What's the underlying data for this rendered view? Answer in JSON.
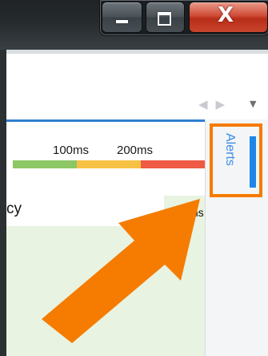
{
  "window": {
    "controls": {
      "minimize_icon": "minimize-icon",
      "maximize_icon": "maximize-icon",
      "close_glyph": "X"
    }
  },
  "toolbar": {
    "nav_prev": "◀",
    "nav_next": "▶",
    "nav_menu": "▼"
  },
  "latency_legend": {
    "labels": [
      "100ms",
      "200ms"
    ],
    "colors": {
      "good": "#8cc665",
      "warning": "#f7c244",
      "critical": "#ee5a44"
    }
  },
  "alerts_tab": {
    "label": "Alerts",
    "highlight_color": "#f57c00",
    "indicator_color": "#1e86e8"
  },
  "content": {
    "title_fragment": "cy",
    "value_fragment": "ms"
  },
  "annotation": {
    "arrow_color": "#f57c00"
  }
}
